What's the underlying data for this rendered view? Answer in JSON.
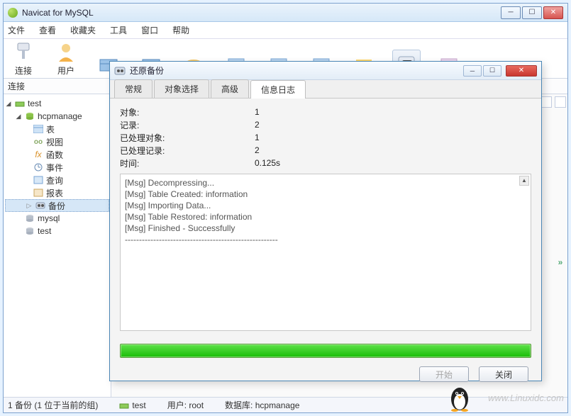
{
  "app": {
    "title": "Navicat for MySQL"
  },
  "menu": {
    "file": "文件",
    "view": "查看",
    "favorites": "收藏夹",
    "tools": "工具",
    "window": "窗口",
    "help": "帮助"
  },
  "toolbar": {
    "connect": "连接",
    "user": "用户"
  },
  "sidebar_label": "连接",
  "tree": {
    "root": "test",
    "db": "hcpmanage",
    "table": "表",
    "view": "视图",
    "func": "函数",
    "event": "事件",
    "query": "查询",
    "report": "报表",
    "backup": "备份",
    "mysql": "mysql",
    "test2": "test"
  },
  "dialog": {
    "title": "还原备份",
    "tabs": {
      "general": "常规",
      "objsel": "对象选择",
      "advanced": "高级",
      "msglog": "信息日志"
    },
    "stats": {
      "objects_label": "对象:",
      "objects_value": "1",
      "records_label": "记录:",
      "records_value": "2",
      "proc_obj_label": "已处理对象:",
      "proc_obj_value": "1",
      "proc_rec_label": "已处理记录:",
      "proc_rec_value": "2",
      "time_label": "时间:",
      "time_value": "0.125s"
    },
    "log": {
      "l1": "[Msg] Decompressing...",
      "l2": "[Msg] Table Created: information",
      "l3": "[Msg] Importing Data...",
      "l4": "[Msg] Table Restored: information",
      "l5": "[Msg] Finished - Successfully",
      "l6": "------------------------------------------------------"
    },
    "buttons": {
      "start": "开始",
      "close": "关闭"
    }
  },
  "status": {
    "left": "1 备份 (1 位于当前的组)",
    "db": "test",
    "user": "用户: root",
    "dbname": "数据库: hcpmanage"
  },
  "watermark": "www.Linuxidc.com"
}
